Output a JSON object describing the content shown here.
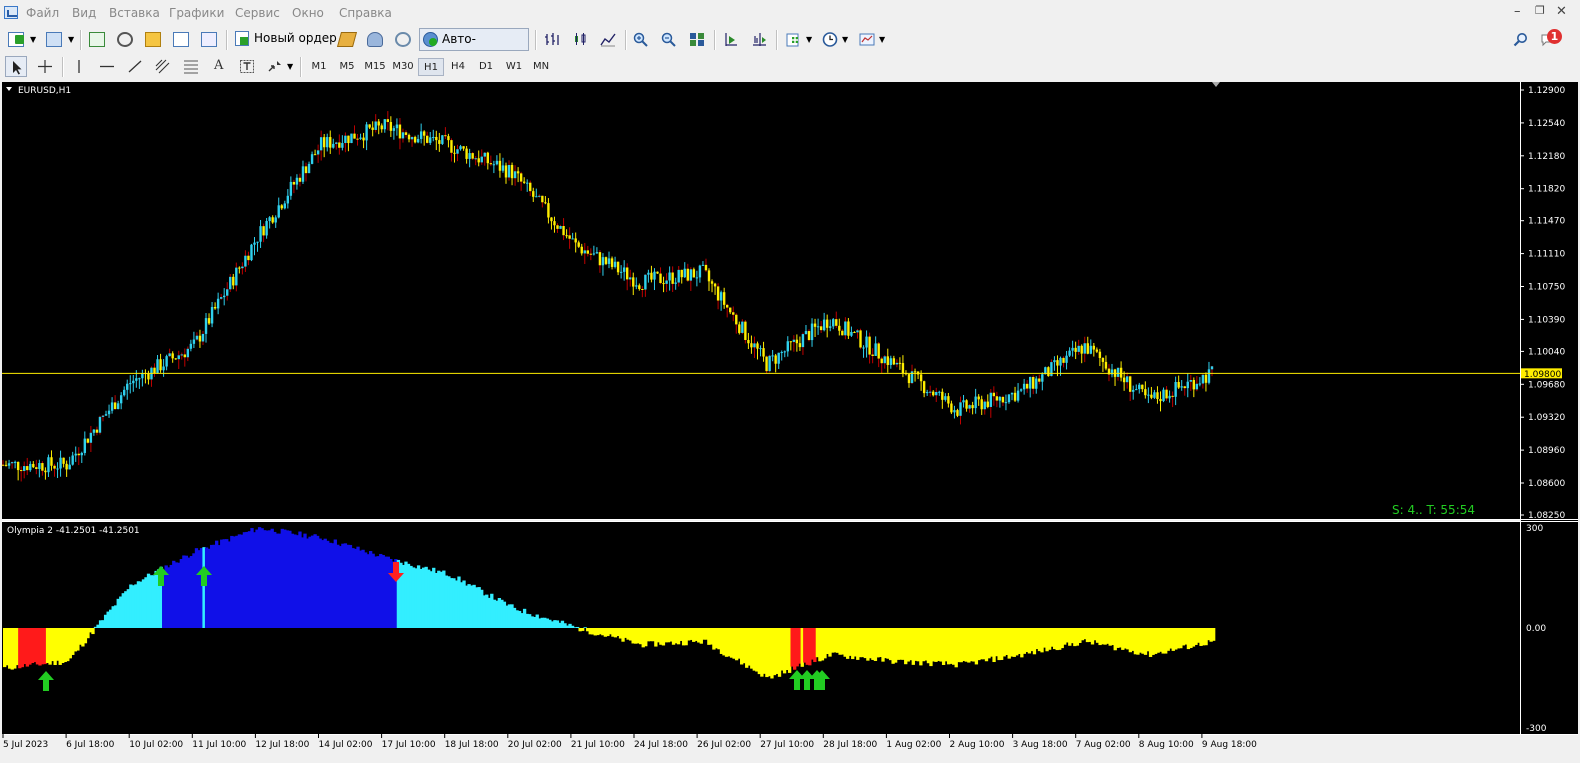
{
  "menu": [
    "Файл",
    "Вид",
    "Вставка",
    "Графики",
    "Сервис",
    "Окно",
    "Справка"
  ],
  "toolbar": {
    "new_order_label": "Новый ордер",
    "autotrading_label": "Авто-торговля",
    "notification_count": "1"
  },
  "timeframes": [
    "M1",
    "M5",
    "M15",
    "M30",
    "H1",
    "H4",
    "D1",
    "W1",
    "MN"
  ],
  "active_timeframe": "H1",
  "main_chart": {
    "symbol_title": "EURUSD,H1",
    "price_labels": [
      "1.12900",
      "1.12540",
      "1.12180",
      "1.11820",
      "1.11470",
      "1.11110",
      "1.10750",
      "1.10390",
      "1.10040",
      "1.09680",
      "1.09320",
      "1.08960",
      "1.08600",
      "1.08250"
    ],
    "current_price": "1.09800",
    "timer_text": "S: 4.. T: 55:54",
    "colors": {
      "background": "#000000",
      "bull": "#2fd0ee",
      "bear": "#ffee00",
      "wick_down": "#c00000",
      "price_line": "#ffee00",
      "axis_text": "#ffffff"
    }
  },
  "indicator": {
    "title": "Olympia 2 -41.2501 -41.2501",
    "scale_labels": [
      "300",
      "0.00",
      "-300"
    ],
    "colors": {
      "cyan": "#33eeff",
      "blue": "#1010e8",
      "yellow": "#ffff00",
      "red": "#ff1a1a",
      "arrow_up": "#22cc22",
      "arrow_down": "#ff2020"
    }
  },
  "time_axis": [
    "5 Jul 2023",
    "6 Jul 18:00",
    "10 Jul 02:00",
    "11 Jul 10:00",
    "12 Jul 18:00",
    "14 Jul 02:00",
    "17 Jul 10:00",
    "18 Jul 18:00",
    "20 Jul 02:00",
    "21 Jul 10:00",
    "24 Jul 18:00",
    "26 Jul 02:00",
    "27 Jul 10:00",
    "28 Jul 18:00",
    "1 Aug 02:00",
    "2 Aug 10:00",
    "3 Aug 18:00",
    "7 Aug 02:00",
    "8 Aug 10:00",
    "9 Aug 18:00"
  ],
  "chart_data": {
    "type": "line",
    "title": "EURUSD,H1",
    "ylim": [
      1.0825,
      1.129
    ],
    "x": [
      "5 Jul 2023",
      "6 Jul 18:00",
      "10 Jul 02:00",
      "11 Jul 10:00",
      "12 Jul 18:00",
      "14 Jul 02:00",
      "17 Jul 10:00",
      "18 Jul 18:00",
      "20 Jul 02:00",
      "21 Jul 10:00",
      "24 Jul 18:00",
      "26 Jul 02:00",
      "27 Jul 10:00",
      "28 Jul 18:00",
      "1 Aug 02:00",
      "2 Aug 10:00",
      "3 Aug 18:00",
      "7 Aug 02:00",
      "8 Aug 10:00",
      "9 Aug 18:00"
    ],
    "series": [
      {
        "name": "EURUSD,H1",
        "values": [
          1.088,
          1.088,
          1.097,
          1.101,
          1.113,
          1.123,
          1.125,
          1.123,
          1.12,
          1.112,
          1.108,
          1.109,
          1.099,
          1.104,
          1.099,
          1.094,
          1.096,
          1.101,
          1.095,
          1.098
        ]
      }
    ],
    "indicator": {
      "name": "Olympia 2",
      "ylim": [
        -300,
        300
      ],
      "values": [
        -120,
        -100,
        130,
        230,
        300,
        270,
        210,
        160,
        60,
        0,
        -50,
        -40,
        -150,
        -80,
        -100,
        -110,
        -80,
        -40,
        -80,
        -40
      ]
    }
  }
}
